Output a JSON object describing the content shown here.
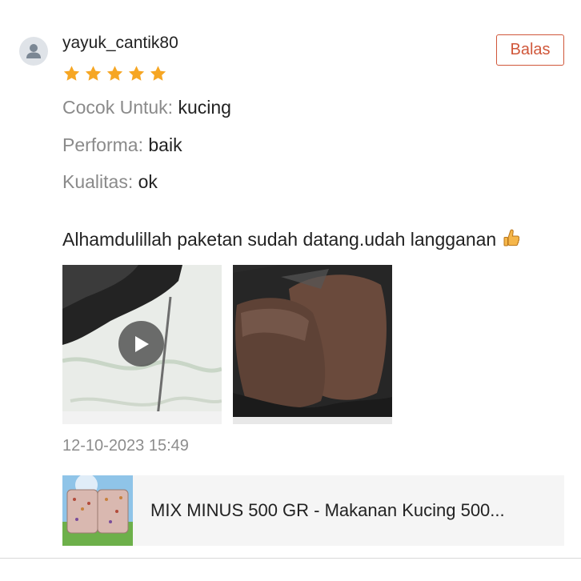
{
  "review": {
    "username": "yayuk_cantik80",
    "rating": 5,
    "reply_label": "Balas",
    "attributes": [
      {
        "key": "Cocok Untuk:",
        "value": "kucing"
      },
      {
        "key": "Performa:",
        "value": "baik"
      },
      {
        "key": "Kualitas:",
        "value": "ok"
      }
    ],
    "comment": "Alhamdulillah paketan sudah datang.udah langganan",
    "comment_emoji": "thumbs-up-icon",
    "media": [
      {
        "type": "video",
        "icon": "play-icon"
      },
      {
        "type": "photo"
      }
    ],
    "timestamp": "12-10-2023 15:49"
  },
  "product": {
    "name": "MIX MINUS 500 GR - Makanan Kucing 500..."
  },
  "colors": {
    "accent": "#d0573a",
    "star": "#f6a623",
    "muted_text": "#8a8a8a",
    "product_bg": "#f5f5f5"
  }
}
